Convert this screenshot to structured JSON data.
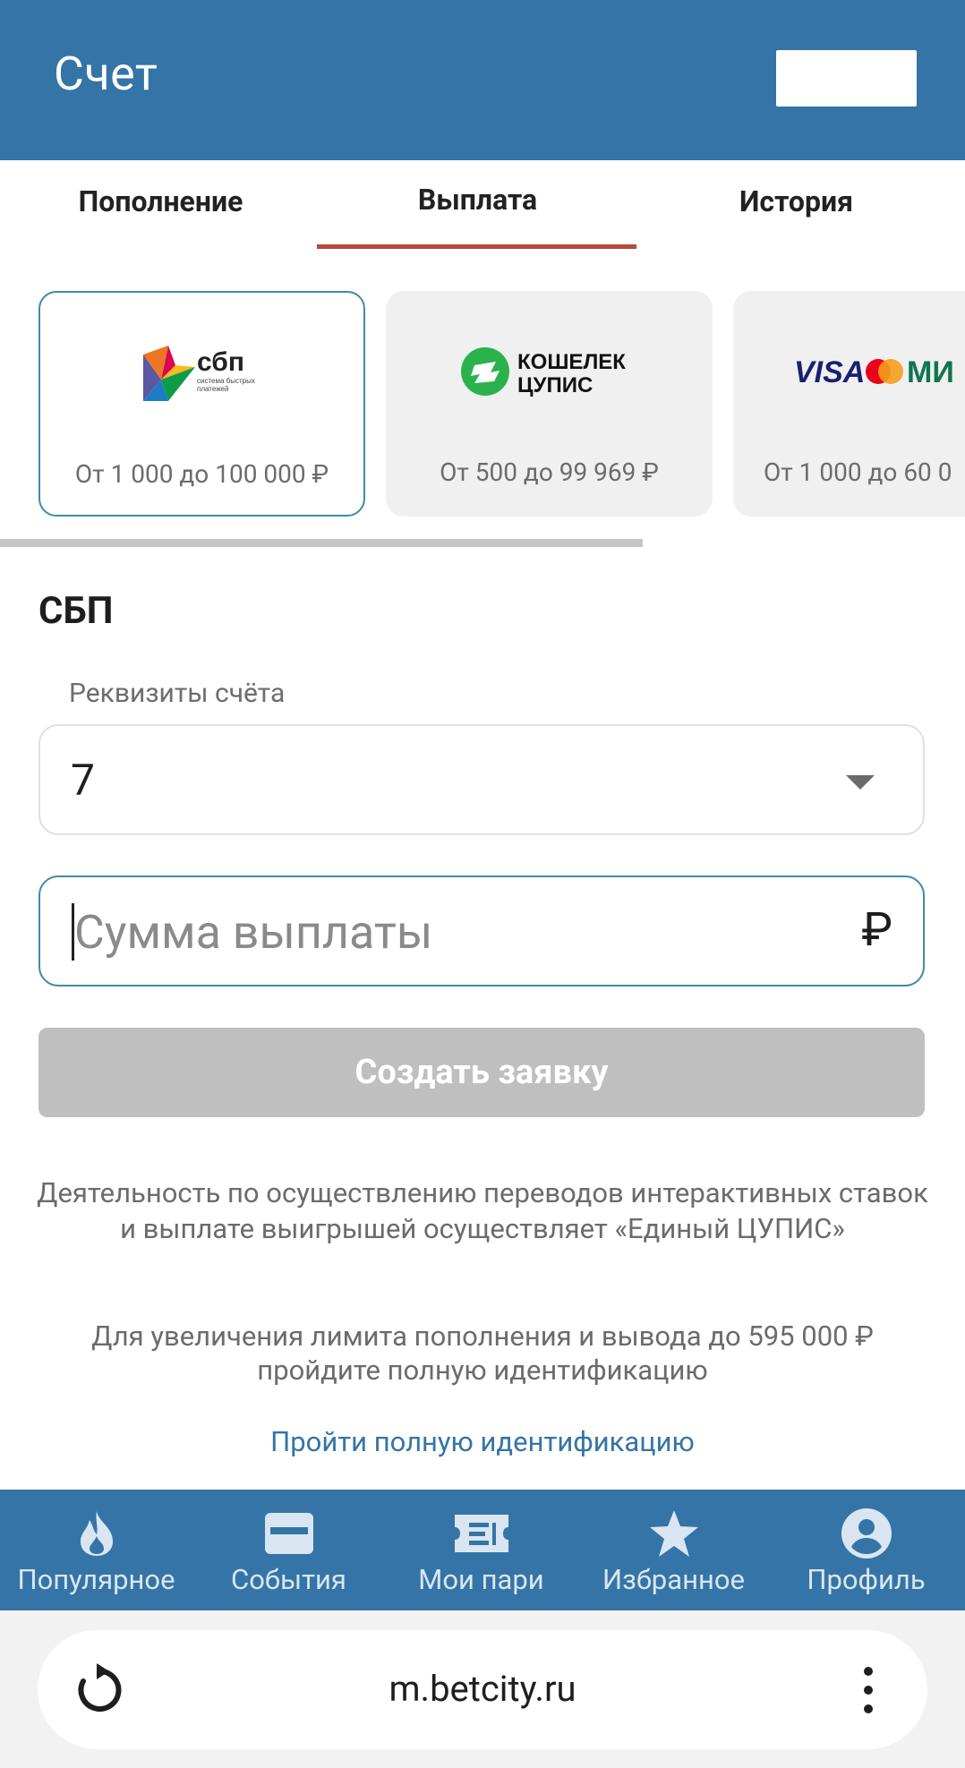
{
  "header": {
    "title": "Счет"
  },
  "tabs": [
    {
      "label": "Пополнение",
      "active": false
    },
    {
      "label": "Выплата",
      "active": true
    },
    {
      "label": "История",
      "active": false
    }
  ],
  "methods": [
    {
      "name": "СБП",
      "logo_text": "сбп",
      "logo_sub": "система быстрых платежей",
      "range": "От 1 000 до 100 000 ₽",
      "selected": true
    },
    {
      "name": "Кошелек ЦУПИС",
      "logo_text_1": "КОШЕЛЕК",
      "logo_text_2": "ЦУПИС",
      "range": "От 500 до 99 969 ₽",
      "selected": false
    },
    {
      "name": "Visa Mastercard Mir",
      "logo_text_1": "VISA",
      "logo_text_2": "МИ",
      "range": "От 1 000 до 60 0",
      "selected": false
    }
  ],
  "form": {
    "section_title": "СБП",
    "account_label": "Реквизиты счёта",
    "account_value": "7",
    "amount_placeholder": "Сумма выплаты",
    "amount_value": "",
    "currency": "₽",
    "submit_label": "Создать заявку"
  },
  "info": {
    "text1": "Деятельность по осуществлению переводов интерактивных ставок и выплате выигрышей осуществляет «Единый ЦУПИС»",
    "text2": "Для увеличения лимита пополнения и вывода до 595 000 ₽ пройдите полную идентификацию",
    "link": "Пройти полную идентификацию"
  },
  "bottom_nav": [
    {
      "label": "Популярное",
      "icon": "flame-icon"
    },
    {
      "label": "События",
      "icon": "card-icon"
    },
    {
      "label": "Мои пари",
      "icon": "ticket-icon"
    },
    {
      "label": "Избранное",
      "icon": "star-icon"
    },
    {
      "label": "Профиль",
      "icon": "profile-icon"
    }
  ],
  "browser": {
    "url": "m.betcity.ru"
  },
  "colors": {
    "primary": "#3574a6",
    "accent": "#b44a3e",
    "selected_border": "#3f8aac",
    "disabled": "#bfbfbf"
  }
}
